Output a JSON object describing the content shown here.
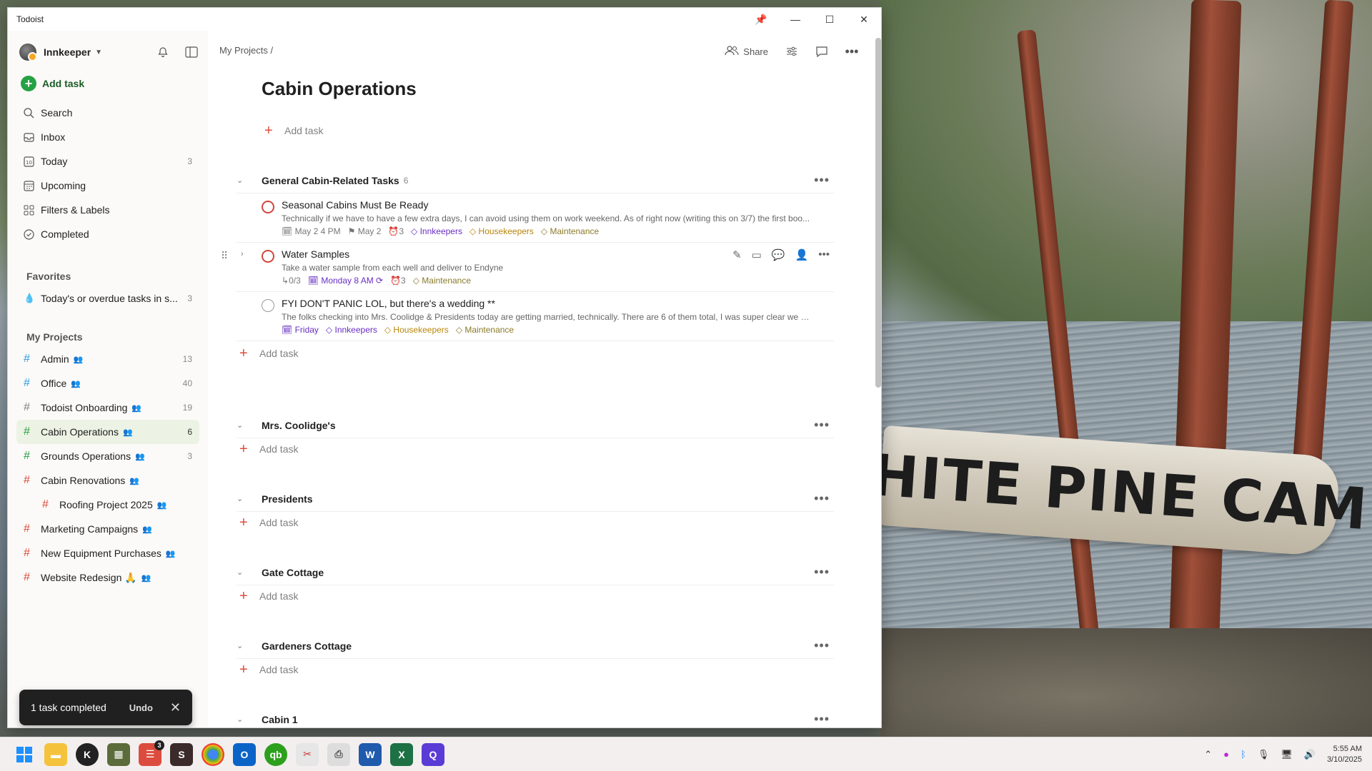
{
  "window": {
    "title": "Todoist"
  },
  "sidebar": {
    "user": "Innkeeper",
    "add_task": "Add task",
    "nav": [
      {
        "label": "Search",
        "icon": "search-icon",
        "count": ""
      },
      {
        "label": "Inbox",
        "icon": "inbox-icon",
        "count": ""
      },
      {
        "label": "Today",
        "icon": "calendar-today-icon",
        "count": "3"
      },
      {
        "label": "Upcoming",
        "icon": "calendar-grid-icon",
        "count": ""
      },
      {
        "label": "Filters & Labels",
        "icon": "grid-icon",
        "count": ""
      },
      {
        "label": "Completed",
        "icon": "check-circle-icon",
        "count": ""
      }
    ],
    "favorites_label": "Favorites",
    "favorites": [
      {
        "label": "Today's or overdue tasks in s...",
        "count": "3"
      }
    ],
    "projects_label": "My Projects",
    "projects": [
      {
        "label": "Admin",
        "count": "13",
        "color": "#299fe6"
      },
      {
        "label": "Office",
        "count": "40",
        "color": "#299fe6"
      },
      {
        "label": "Todoist Onboarding",
        "count": "19",
        "color": "#808080"
      },
      {
        "label": "Cabin Operations",
        "count": "6",
        "color": "#25a244"
      },
      {
        "label": "Grounds Operations",
        "count": "3",
        "color": "#25a244"
      },
      {
        "label": "Cabin Renovations",
        "count": "",
        "color": "#dc4c3e"
      },
      {
        "label": "Roofing Project 2025",
        "count": "",
        "color": "#dc4c3e"
      },
      {
        "label": "Marketing Campaigns",
        "count": "",
        "color": "#dc4c3e"
      },
      {
        "label": "New Equipment Purchases",
        "count": "",
        "color": "#dc4c3e"
      },
      {
        "label": "Website Redesign 🙏",
        "count": "",
        "color": "#dc4c3e"
      }
    ],
    "toast": {
      "text": "1 task completed",
      "undo": "Undo"
    }
  },
  "main": {
    "breadcrumb": "My Projects /",
    "share": "Share",
    "title": "Cabin Operations",
    "add_task": "Add task",
    "sections": [
      {
        "name": "General Cabin-Related Tasks",
        "count": "6",
        "tasks": [
          {
            "title": "Seasonal Cabins Must Be Ready",
            "desc": "Technically if we have to have a few extra days, I can avoid using them on work weekend. As of right now (writing this on 3/7) the first boo...",
            "meta": [
              "May 2 4 PM",
              "May 2",
              "3",
              "Innkeepers",
              "Housekeepers",
              "Maintenance"
            ]
          },
          {
            "title": "Water Samples",
            "desc": "Take a water sample from each well and deliver to Endyne",
            "meta": [
              "0/3",
              "Monday 8 AM",
              "3",
              "Maintenance"
            ]
          },
          {
            "title": "FYI DON'T PANIC LOL, but there's a wedding **",
            "desc": "The folks checking into Mrs. Coolidge & Presidents today are getting married, technically. There are 6 of them total, I was super clear we w...",
            "meta": [
              "Friday",
              "Innkeepers",
              "Housekeepers",
              "Maintenance"
            ]
          }
        ]
      },
      {
        "name": "Mrs. Coolidge's"
      },
      {
        "name": "Presidents"
      },
      {
        "name": "Gate Cottage"
      },
      {
        "name": "Gardeners Cottage"
      },
      {
        "name": "Cabin 1"
      }
    ]
  },
  "wallpaper": {
    "sign_text": "WHITE PINE CAMP"
  },
  "taskbar": {
    "time": "5:55 AM",
    "date": "3/10/2025",
    "todoist_badge": "3"
  }
}
